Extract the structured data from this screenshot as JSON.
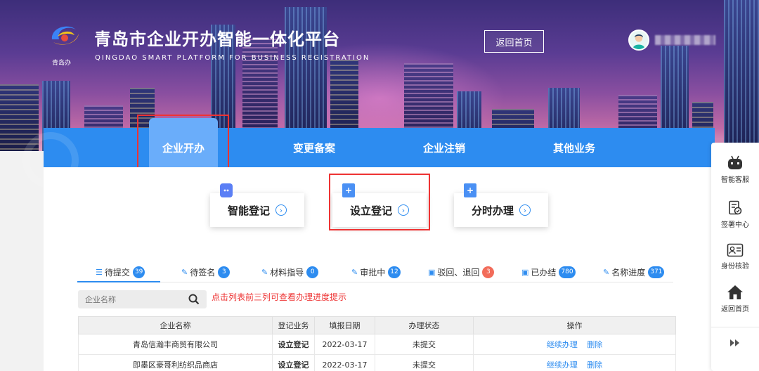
{
  "header": {
    "logo_caption": "青岛办",
    "title": "青岛市企业开办智能一体化平台",
    "subtitle": "QINGDAO SMART PLATFORM FOR BUSINESS REGISTRATION",
    "home_button": "返回首页"
  },
  "nav": {
    "items": [
      {
        "label": "企业开办",
        "active": true
      },
      {
        "label": "变更备案"
      },
      {
        "label": "企业注销"
      },
      {
        "label": "其他业务"
      }
    ]
  },
  "cards": [
    {
      "label": "智能登记",
      "icon": "robot-icon"
    },
    {
      "label": "设立登记",
      "icon": "file-add-icon"
    },
    {
      "label": "分时办理",
      "icon": "file-add-icon"
    }
  ],
  "tabs": [
    {
      "label": "待提交",
      "count": "39",
      "icon": "list-icon"
    },
    {
      "label": "待签名",
      "count": "3",
      "icon": "edit-icon"
    },
    {
      "label": "材料指导",
      "count": "0",
      "icon": "edit-icon"
    },
    {
      "label": "审批中",
      "count": "12",
      "icon": "edit-icon"
    },
    {
      "label": "驳回、退回",
      "count": "3",
      "icon": "briefcase-icon"
    },
    {
      "label": "已办结",
      "count": "780",
      "icon": "briefcase-icon"
    },
    {
      "label": "名称进度",
      "count": "371",
      "icon": "edit-icon"
    }
  ],
  "search": {
    "placeholder": "企业名称"
  },
  "hint": "点击列表前三列可查看办理进度提示",
  "table": {
    "headers": [
      "企业名称",
      "登记业务",
      "填报日期",
      "办理状态",
      "操作"
    ],
    "rows": [
      {
        "name": "青岛信瀚丰商贸有限公司",
        "type": "设立登记",
        "date": "2022-03-17",
        "status": "未提交",
        "actions": [
          "继续办理",
          "删除"
        ]
      },
      {
        "name": "即墨区豪哥利纺织品商店",
        "type": "设立登记",
        "date": "2022-03-17",
        "status": "未提交",
        "actions": [
          "继续办理",
          "删除"
        ]
      }
    ]
  },
  "rail": {
    "items": [
      {
        "label": "智能客服",
        "icon": "robot-icon"
      },
      {
        "label": "签署中心",
        "icon": "sign-doc-icon"
      },
      {
        "label": "身份核验",
        "icon": "id-card-icon"
      },
      {
        "label": "返回首页",
        "icon": "home-icon"
      }
    ],
    "collapse_icon": "double-chevron-right-icon"
  },
  "colors": {
    "primary": "#2d8cf0",
    "nav_active": "#6aadfa",
    "highlight": "#ee3333"
  }
}
